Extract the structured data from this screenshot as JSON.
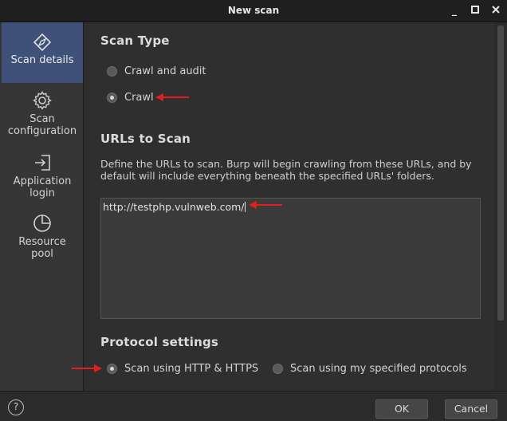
{
  "window": {
    "title": "New scan"
  },
  "sidebar": {
    "items": [
      {
        "label": "Scan details",
        "icon": "compass-icon"
      },
      {
        "label": "Scan configuration",
        "icon": "gear-icon"
      },
      {
        "label": "Application login",
        "icon": "login-icon"
      },
      {
        "label": "Resource pool",
        "icon": "pie-chart-icon"
      }
    ]
  },
  "scan_type": {
    "title": "Scan Type",
    "options": [
      "Crawl and audit",
      "Crawl"
    ],
    "selected": "Crawl"
  },
  "urls": {
    "title": "URLs to Scan",
    "description": "Define the URLs to scan. Burp will begin crawling from these URLs, and by default will include everything beneath the specified URLs' folders.",
    "value": "http://testphp.vulnweb.com/"
  },
  "protocol": {
    "title": "Protocol settings",
    "options": [
      "Scan using HTTP & HTTPS",
      "Scan using my specified protocols"
    ],
    "selected": "Scan using HTTP & HTTPS"
  },
  "footer": {
    "help": "?",
    "ok": "OK",
    "cancel": "Cancel"
  },
  "colors": {
    "active_nav": "#3f5178",
    "annotation_arrow": "#e02020"
  }
}
